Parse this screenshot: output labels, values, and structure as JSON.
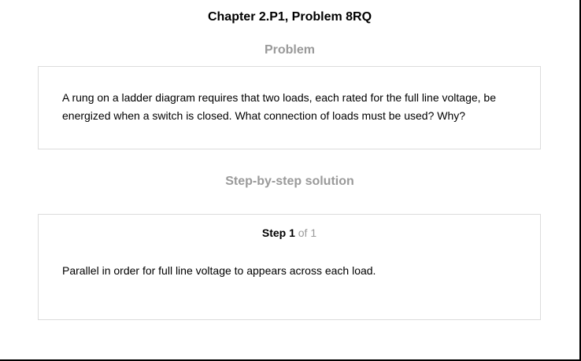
{
  "header": {
    "chapter_title": "Chapter 2.P1, Problem 8RQ"
  },
  "problem": {
    "heading": "Problem",
    "text": "A rung on a ladder diagram requires that two loads, each rated for the full line voltage, be energized when a switch is closed. What connection of loads must be used? Why?"
  },
  "solution": {
    "heading": "Step-by-step solution",
    "step": {
      "label": "Step 1",
      "of_text": "of 1",
      "text": "Parallel in order for full line voltage to appears across each load."
    }
  }
}
